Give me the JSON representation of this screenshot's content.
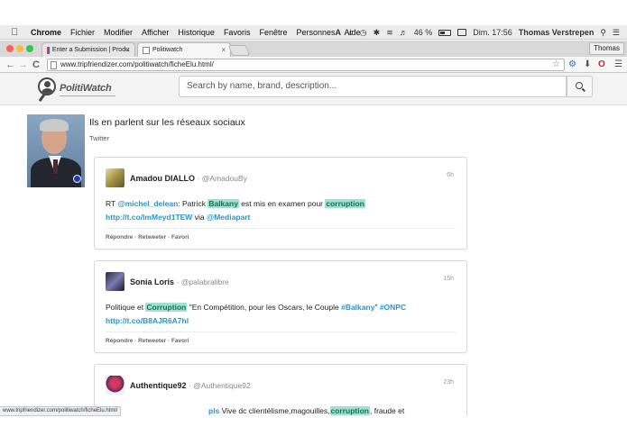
{
  "menubar": {
    "app": "Chrome",
    "items": [
      "Fichier",
      "Modifier",
      "Afficher",
      "Historique",
      "Favoris",
      "Fenêtre",
      "Personnes",
      "Aide"
    ],
    "battery": "46 %",
    "clock": "Dim. 17:56",
    "user": "Thomas Verstrepen"
  },
  "tabs": [
    {
      "title": "Enter a Submission | Produ"
    },
    {
      "title": "Politiwatch"
    }
  ],
  "profile_button": "Thomas",
  "address_bar": {
    "url": "www.tripfriendizer.com/politiwatch/ficheElu.html/"
  },
  "site": {
    "logo_text": "PolitiWatch",
    "search_placeholder": "Search by name, brand, description..."
  },
  "section": {
    "title": "Ils en parlent sur les réseaux sociaux",
    "subtitle": "Twitter"
  },
  "tweets": [
    {
      "name": "Amadou DIALLO",
      "handle": "@AmadouBy",
      "time": "6h",
      "parts": [
        "RT ",
        "@michel_delean",
        ": Patrick ",
        "Balkany",
        " est mis en examen pour ",
        "corruption"
      ],
      "line2": [
        "http://t.co/lmMeyd1TEW",
        " via ",
        "@Mediapart"
      ],
      "actions": "Répondre · Retweeter · Favori"
    },
    {
      "name": "Sonia Loris",
      "handle": "@palabralibre",
      "time": "15h",
      "parts": [
        "Politique et ",
        "Corruption",
        " \"En Compétition, pour les Oscars, le Couple ",
        "#Balkany",
        "\" ",
        "#ONPC"
      ],
      "line2": [
        "http://t.co/B8AJR6A7hl"
      ],
      "actions": "Répondre · Retweeter · Favori"
    },
    {
      "name": "Authentique92",
      "handle": "@Authentique92",
      "time": "23h",
      "parts": [
        "pls",
        " Vive dc clientélisme,magouilles,",
        "corruption",
        ", fraude et"
      ]
    }
  ],
  "statusbar": "www.tripfriendizer.com/politiwatch/ficheElu.html/",
  "colors": {
    "highlight": "#9fe3cf",
    "link": "#2a95c8"
  }
}
